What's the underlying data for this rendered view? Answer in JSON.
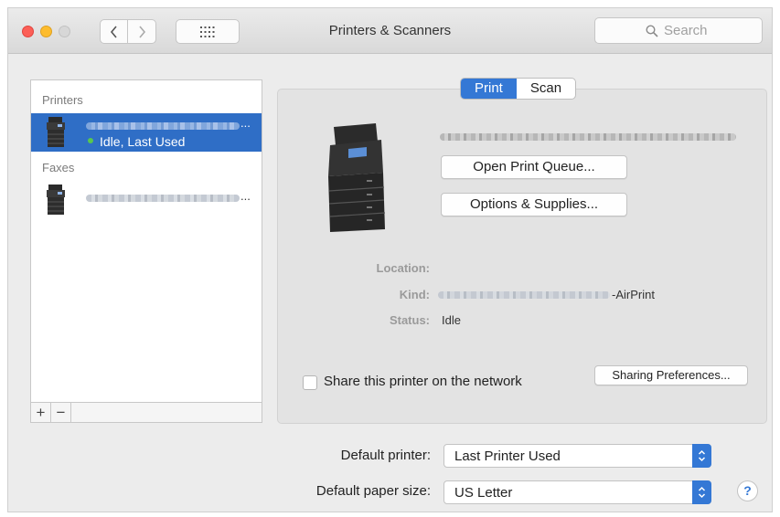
{
  "window": {
    "title": "Printers & Scanners"
  },
  "toolbar": {
    "search_placeholder": "Search"
  },
  "sidebar": {
    "printers_heading": "Printers",
    "faxes_heading": "Faxes",
    "printer_item": {
      "ellipsis": "...",
      "status": "Idle, Last Used"
    },
    "fax_item": {
      "ellipsis": "..."
    },
    "add_label": "+",
    "remove_label": "−"
  },
  "tabs": [
    {
      "label": "Print"
    },
    {
      "label": "Scan"
    }
  ],
  "printer": {
    "open_queue_label": "Open Print Queue...",
    "options_supplies_label": "Options & Supplies...",
    "location_label": "Location:",
    "location_value": "",
    "kind_label": "Kind:",
    "kind_suffix": "-AirPrint",
    "status_label": "Status:",
    "status_value": "Idle"
  },
  "sharing": {
    "checkbox_label": "Share this printer on the network",
    "checked": false,
    "prefs_button_label": "Sharing Preferences..."
  },
  "defaults": {
    "printer_label": "Default printer:",
    "printer_value": "Last Printer Used",
    "paper_label": "Default paper size:",
    "paper_value": "US Letter"
  },
  "help_label": "?",
  "colors": {
    "accent": "#3478d5",
    "selection": "#2f6ec6",
    "status_dot": "#58c74f"
  },
  "icons": [
    "close-light",
    "minimize-light",
    "zoom-light",
    "chevron-left-icon",
    "chevron-right-icon",
    "grid-icon",
    "search-icon",
    "printer-icon",
    "fax-icon",
    "chevron-updown-icon",
    "help-icon"
  ]
}
